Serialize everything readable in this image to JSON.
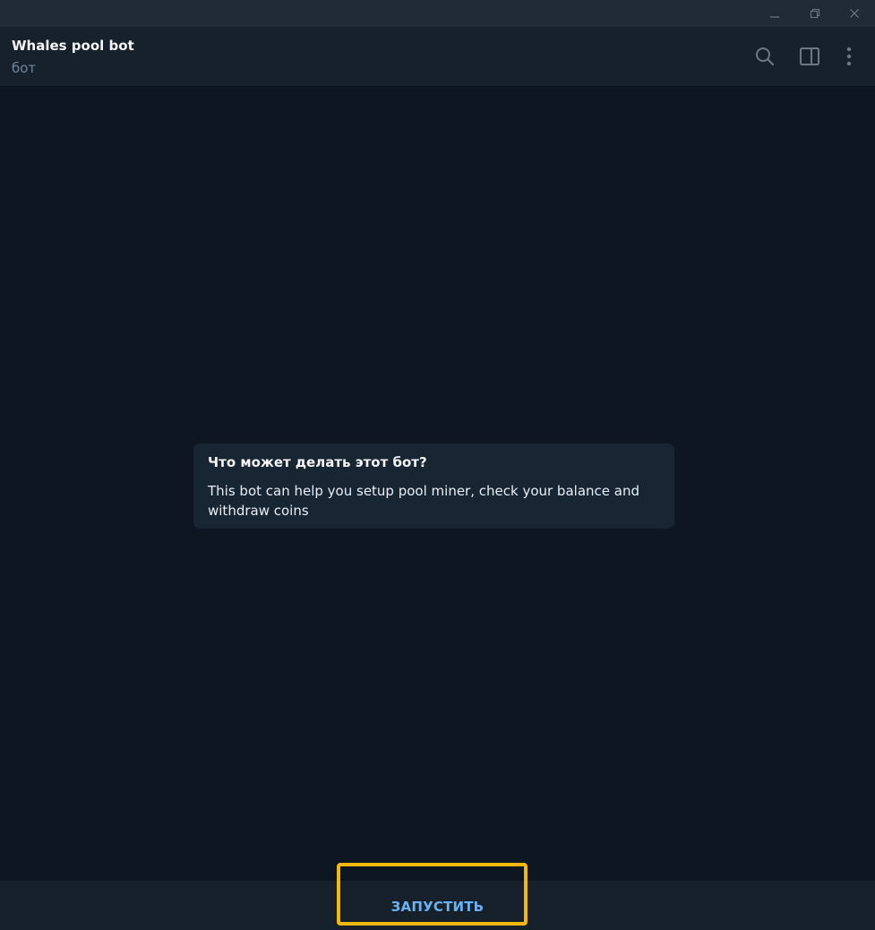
{
  "window": {
    "controls": [
      "minimize-icon",
      "restore-icon",
      "close-icon"
    ]
  },
  "header": {
    "title": "Whales pool bot",
    "subtitle": "бот",
    "icons": [
      "search-icon",
      "sidebar-panel-icon",
      "more-vertical-icon"
    ]
  },
  "info_card": {
    "title": "Что может делать этот бот?",
    "text": "This bot can help you setup pool miner, check your balance and withdraw coins"
  },
  "bottom": {
    "start_label": "ЗАПУСТИТЬ"
  },
  "colors": {
    "background": "#0e1621",
    "header": "#17212b",
    "card": "#182533",
    "accent": "#6ab3f3",
    "highlight": "#f2b90c"
  }
}
